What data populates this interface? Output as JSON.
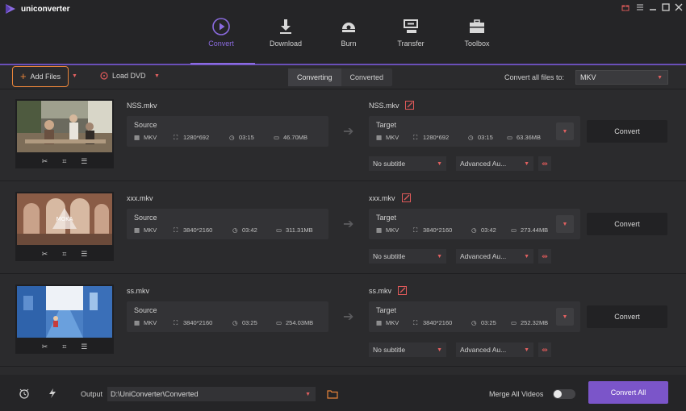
{
  "app": {
    "title": "uniconverter"
  },
  "nav": [
    {
      "label": "Convert",
      "icon": "convert-icon",
      "active": true
    },
    {
      "label": "Download",
      "icon": "download-icon"
    },
    {
      "label": "Burn",
      "icon": "burn-icon"
    },
    {
      "label": "Transfer",
      "icon": "transfer-icon"
    },
    {
      "label": "Toolbox",
      "icon": "toolbox-icon"
    }
  ],
  "toolbar": {
    "add_files": "Add Files",
    "load_dvd": "Load DVD",
    "tab_converting": "Converting",
    "tab_converted": "Converted",
    "convert_all_to_label": "Convert all files to:",
    "convert_all_to_value": "MKV"
  },
  "files": [
    {
      "name": "NSS.mkv",
      "source": {
        "label": "Source",
        "format": "MKV",
        "resolution": "1280*692",
        "duration": "03:15",
        "size": "46.70MB"
      },
      "target_name": "NSS.mkv",
      "target": {
        "label": "Target",
        "format": "MKV",
        "resolution": "1280*692",
        "duration": "03:15",
        "size": "63.36MB"
      },
      "subtitle": "No subtitle",
      "audio": "Advanced Au...",
      "convert": "Convert"
    },
    {
      "name": "xxx.mkv",
      "source": {
        "label": "Source",
        "format": "MKV",
        "resolution": "3840*2160",
        "duration": "03:42",
        "size": "311.31MB"
      },
      "target_name": "xxx.mkv",
      "target": {
        "label": "Target",
        "format": "MKV",
        "resolution": "3840*2160",
        "duration": "03:42",
        "size": "273.44MB"
      },
      "subtitle": "No subtitle",
      "audio": "Advanced Au...",
      "convert": "Convert"
    },
    {
      "name": "ss.mkv",
      "source": {
        "label": "Source",
        "format": "MKV",
        "resolution": "3840*2160",
        "duration": "03:25",
        "size": "254.03MB"
      },
      "target_name": "ss.mkv",
      "target": {
        "label": "Target",
        "format": "MKV",
        "resolution": "3840*2160",
        "duration": "03:25",
        "size": "252.32MB"
      },
      "subtitle": "No subtitle",
      "audio": "Advanced Au...",
      "convert": "Convert"
    }
  ],
  "bottom": {
    "output_label": "Output",
    "output_path": "D:\\UniConverter\\Converted",
    "merge_label": "Merge All Videos",
    "convert_all": "Convert All"
  },
  "colors": {
    "accent": "#7b55c9",
    "highlight": "#e8843a",
    "red": "#e05a5a"
  }
}
